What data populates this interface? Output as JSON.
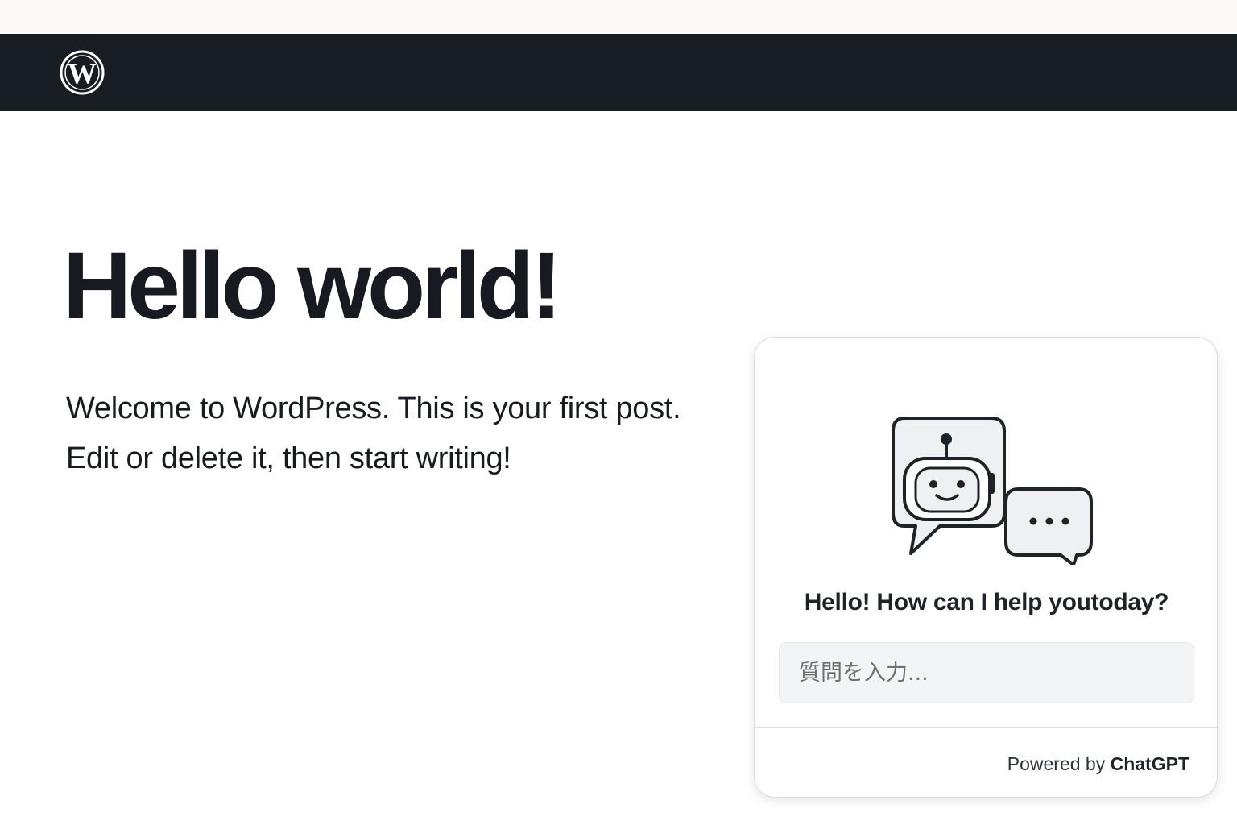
{
  "header": {
    "logo_icon": "wordpress-logo-icon",
    "background_color": "#181d24"
  },
  "post": {
    "title": "Hello world!",
    "body_lines": [
      "Welcome to WordPress. This is your first post.",
      "Edit or delete it, then start writing!"
    ]
  },
  "chat_widget": {
    "illustration_icon": "chatbot-robot-icon",
    "greeting": "Hello! How can I help youtoday?",
    "input": {
      "value": "",
      "placeholder": "質問を入力..."
    },
    "footer": {
      "powered_by_text": "Powered by ",
      "brand": "ChatGPT"
    }
  }
}
